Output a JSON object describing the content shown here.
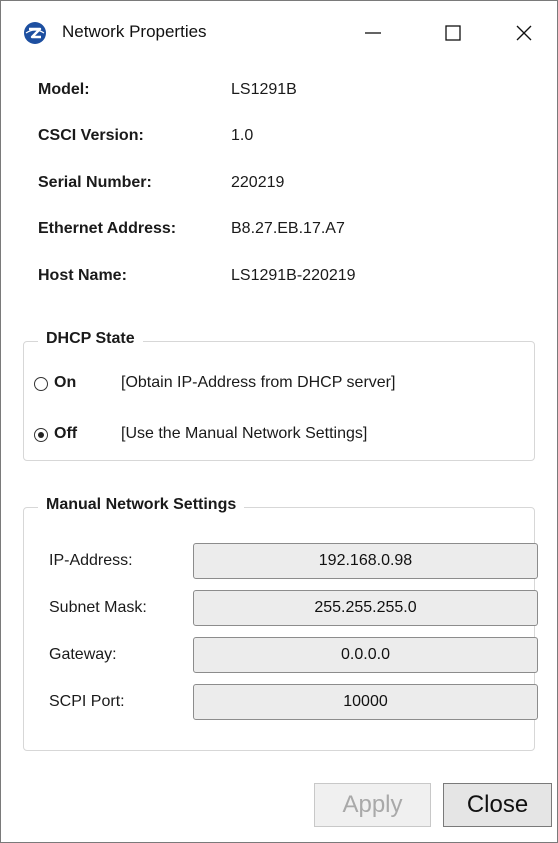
{
  "window": {
    "title": "Network Properties",
    "logo_color": "#1d4fa0"
  },
  "info": [
    {
      "label": "Model:",
      "value": "LS1291B"
    },
    {
      "label": "CSCI Version:",
      "value": "1.0"
    },
    {
      "label": "Serial Number:",
      "value": "220219"
    },
    {
      "label": "Ethernet Address:",
      "value": "B8.27.EB.17.A7"
    },
    {
      "label": "Host Name:",
      "value": "LS1291B-220219"
    }
  ],
  "dhcp": {
    "title": "DHCP State",
    "options": [
      {
        "label": "On",
        "description": "[Obtain IP-Address from DHCP server]",
        "checked": false
      },
      {
        "label": "Off",
        "description": "[Use the Manual Network Settings]",
        "checked": true
      }
    ]
  },
  "manual": {
    "title": "Manual Network Settings",
    "fields": [
      {
        "label": "IP-Address:",
        "value": "192.168.0.98"
      },
      {
        "label": "Subnet Mask:",
        "value": "255.255.255.0"
      },
      {
        "label": "Gateway:",
        "value": "0.0.0.0"
      },
      {
        "label": "SCPI Port:",
        "value": "10000"
      }
    ]
  },
  "buttons": {
    "apply_label": "Apply",
    "apply_enabled": false,
    "close_label": "Close"
  }
}
